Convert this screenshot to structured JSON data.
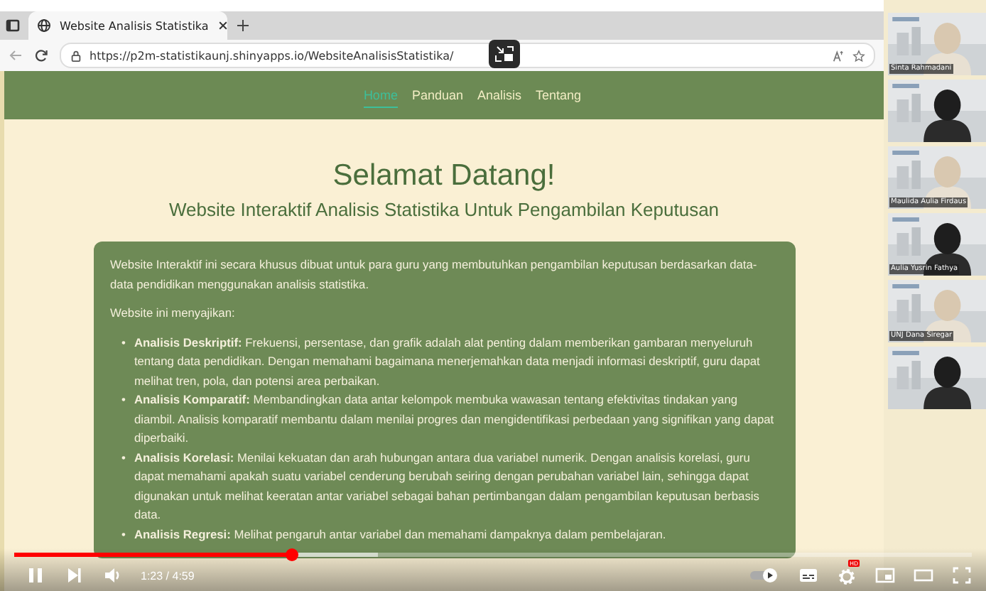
{
  "browser": {
    "tab_title": "Website Analisis Statistika",
    "url": "https://p2m-statistikaunj.shinyapps.io/WebsiteAnalisisStatistika/"
  },
  "nav": [
    {
      "label": "Home",
      "selected": true
    },
    {
      "label": "Panduan",
      "selected": false
    },
    {
      "label": "Analisis",
      "selected": false
    },
    {
      "label": "Tentang",
      "selected": false
    }
  ],
  "heading": "Selamat Datang!",
  "subtitle": "Website Interaktif Analisis Statistika Untuk Pengambilan Keputusan",
  "intro": "Website Interaktif ini secara khusus dibuat untuk para guru yang membutuhkan pengambilan keputusan berdasarkan data-data pendidikan menggunakan analisis statistika.",
  "list_label": "Website ini menyajikan:",
  "items": [
    {
      "bullet": "•",
      "text": "**Analisis Deskriptif:** Frekuensi, persentase, dan grafik adalah alat penting dalam memberikan gambaran menyeluruh tentang data pendidikan. Dengan memahami bagaimana menerjemahkan data menjadi informasi deskriptif, guru dapat melihat tren, pola, dan potensi area perbaikan."
    },
    {
      "bullet": "•",
      "text": "**Analisis Komparatif:** Membandingkan data antar kelompok membuka wawasan tentang efektivitas tindakan yang diambil. Analisis komparatif membantu dalam menilai progres dan mengidentifikasi perbedaan yang signifikan yang dapat diperbaiki."
    },
    {
      "bullet": "•",
      "text": "**Analisis Korelasi:** Menilai kekuatan dan arah hubungan antara dua variabel numerik. Dengan analisis korelasi, guru dapat memahami apakah suatu variabel cenderung berubah seiring dengan perubahan variabel lain, sehingga dapat digunakan untuk melihat keeratan antar variabel sebagai bahan pertimbangan dalam pengambilan keputusan berbasis data."
    },
    {
      "bullet": "•",
      "text": "**Analisis Regresi:** Melihat pengaruh antar variabel dan memahami dampaknya dalam pembelajaran."
    }
  ],
  "participants": [
    {
      "kind": "picture",
      "name": "Sinta Rahmadani"
    },
    {
      "kind": "picture"
    },
    {
      "kind": "picture",
      "name": "Maulida Aulia Firdaus"
    },
    {
      "kind": "picture",
      "name": "Aulia Yusrin Fathya"
    },
    {
      "kind": "picture",
      "name": "UNJ Dana Siregar"
    },
    {
      "kind": "picture"
    }
  ],
  "player": {
    "level": 0.29,
    "buffer": {
      "level": 0.38
    },
    "time": "1:23 / 4:59",
    "quality_badge": "HD"
  }
}
